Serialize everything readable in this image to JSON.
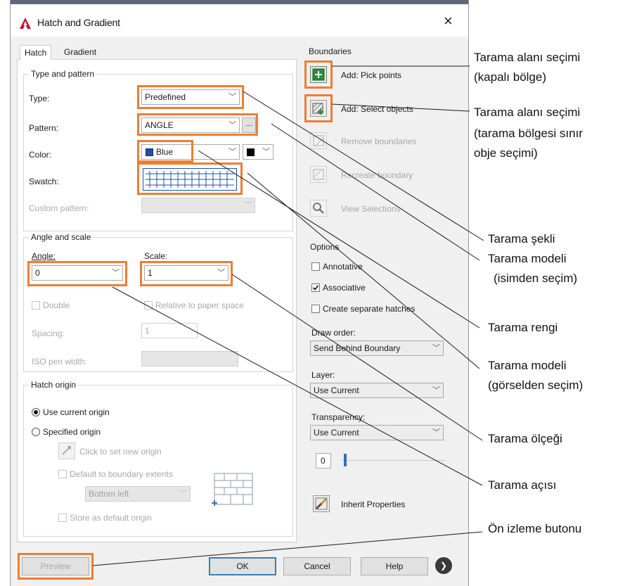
{
  "dialog": {
    "title": "Hatch and Gradient",
    "close_glyph": "×",
    "app_icon": "autocad-logo-icon"
  },
  "tabs": [
    {
      "label": "Hatch",
      "active": true
    },
    {
      "label": "Gradient",
      "active": false
    }
  ],
  "type_pattern": {
    "group_label": "Type and pattern",
    "type_label": "Type:",
    "type_value": "Predefined",
    "pattern_label": "Pattern:",
    "pattern_value": "ANGLE",
    "pattern_browse": "...",
    "color_label": "Color:",
    "color_value": "Blue",
    "swatch_label": "Swatch:",
    "custom_pattern_label": "Custom pattern:",
    "accent_blue": "#1f4fa8"
  },
  "angle_scale": {
    "group_label": "Angle and scale",
    "angle_label": "Angle:",
    "angle_value": "0",
    "scale_label": "Scale:",
    "scale_value": "1",
    "double_label": "Double",
    "relative_label": "Relative to paper space",
    "spacing_label": "Spacing:",
    "spacing_value": "1",
    "iso_label": "ISO pen width:"
  },
  "hatch_origin": {
    "group_label": "Hatch origin",
    "use_current": "Use current origin",
    "specified": "Specified origin",
    "click_to_set": "Click to set new origin",
    "default_extents": "Default to boundary extents",
    "position_value": "Bottom left",
    "store_default": "Store as default origin"
  },
  "boundaries": {
    "group_label": "Boundaries",
    "add_pick": "Add: Pick points",
    "add_select": "Add: Select objects",
    "remove": "Remove boundaries",
    "recreate": "Recreate boundary",
    "view_selections": "View Selections"
  },
  "options": {
    "group_label": "Options",
    "annotative": "Annotative",
    "associative": "Associative",
    "associative_checked": true,
    "separate": "Create separate hatches",
    "draw_order_label": "Draw order:",
    "draw_order_value": "Send Behind Boundary",
    "layer_label": "Layer:",
    "layer_value": "Use Current",
    "transparency_label": "Transparency:",
    "transparency_value": "Use Current",
    "transparency_number": "0",
    "inherit": "Inherit Properties"
  },
  "footer": {
    "preview": "Preview",
    "ok": "OK",
    "cancel": "Cancel",
    "help": "Help",
    "more_glyph": "❯"
  },
  "annotations": {
    "boundary_pick_1": "Tarama alanı seçimi",
    "boundary_pick_2": "(kapalı bölge)",
    "boundary_select_1": "Tarama alanı seçimi",
    "boundary_select_2": "(tarama bölgesi sınır",
    "boundary_select_3": "obje seçimi)",
    "type": "Tarama şekli",
    "pattern_1": "Tarama modeli",
    "pattern_2": "(isimden seçim)",
    "color": "Tarama rengi",
    "swatch_1": "Tarama modeli",
    "swatch_2": "(görselden seçim)",
    "scale": "Tarama ölçeği",
    "angle": "Tarama açısı",
    "preview": "Ön  izleme butonu",
    "highlight_color": "#ef7d31"
  }
}
